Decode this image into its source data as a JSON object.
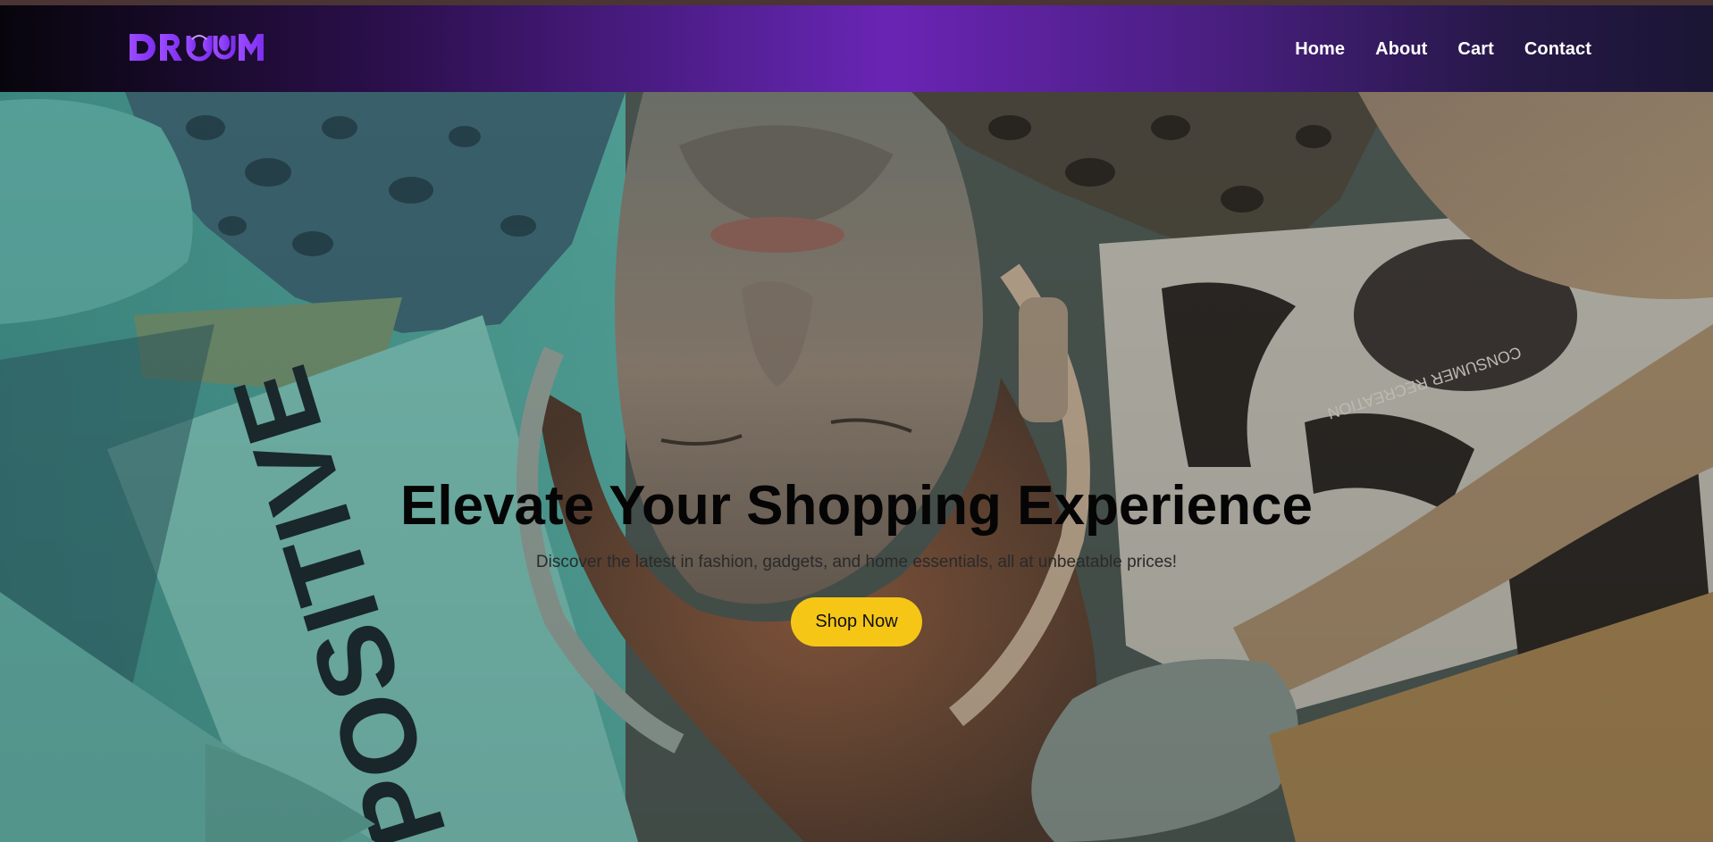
{
  "brand": {
    "logo_text": "DRUM",
    "accent_color": "#8a3cff"
  },
  "nav": {
    "items": [
      {
        "label": "Home"
      },
      {
        "label": "About"
      },
      {
        "label": "Cart"
      },
      {
        "label": "Contact"
      }
    ]
  },
  "hero": {
    "title": "Elevate Your Shopping Experience",
    "subtitle": "Discover the latest in fashion, gadgets, and home essentials, all at unbeatable prices!",
    "cta_label": "Shop Now",
    "cta_color": "#f6c617",
    "background_image": "person-lying-with-headphones-photo",
    "poster_text": "POSITIVE",
    "shirt_text": "CONSUMER RECREATION"
  }
}
